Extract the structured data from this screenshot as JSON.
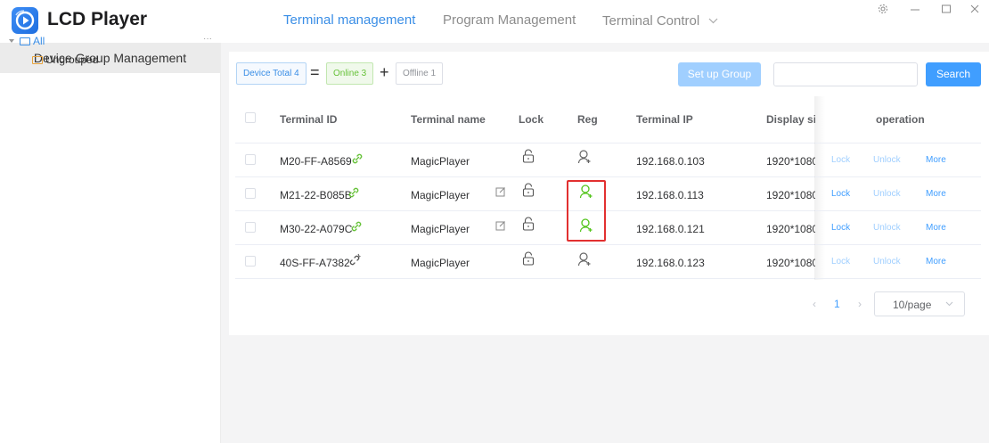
{
  "app": {
    "title": "LCD Player"
  },
  "nav": [
    {
      "label": "Terminal management",
      "active": true
    },
    {
      "label": "Program Management",
      "active": false
    },
    {
      "label": "Terminal Control",
      "active": false
    }
  ],
  "window_controls": {
    "settings": "settings-icon",
    "minimize": "minimize-icon",
    "maximize": "maximize-icon",
    "close": "close-icon"
  },
  "sidebar": {
    "title": "Device Group Management",
    "tree": [
      {
        "label": "All",
        "more": "···"
      },
      {
        "label": "Ungrouped"
      }
    ]
  },
  "summary": {
    "total": "Device Total 4",
    "equals": "=",
    "online": "Online 3",
    "plus": "+",
    "offline": "Offline 1"
  },
  "toolbar": {
    "setup_group": "Set up Group",
    "search_placeholder": "",
    "search_button": "Search"
  },
  "table": {
    "columns": [
      "Terminal ID",
      "Terminal name",
      "Lock",
      "Reg",
      "Terminal IP",
      "Display si",
      "operation"
    ],
    "rows": [
      {
        "id": "M20-FF-A8569",
        "name": "MagicPlayer",
        "editable": false,
        "reg_active": false,
        "ip": "192.168.0.103",
        "display": "1920*1080",
        "online": true
      },
      {
        "id": "M21-22-B085B",
        "name": "MagicPlayer",
        "editable": true,
        "reg_active": true,
        "ip": "192.168.0.113",
        "display": "1920*1080",
        "online": true
      },
      {
        "id": "M30-22-A079C",
        "name": "MagicPlayer",
        "editable": true,
        "reg_active": true,
        "ip": "192.168.0.121",
        "display": "1920*1080",
        "online": true
      },
      {
        "id": "40S-FF-A7382",
        "name": "MagicPlayer",
        "editable": false,
        "reg_active": false,
        "ip": "192.168.0.123",
        "display": "1920*1080",
        "online": false
      }
    ],
    "actions": {
      "lock": "Lock",
      "unlock": "Unlock",
      "more": "More"
    }
  },
  "pagination": {
    "prev": "‹",
    "page": "1",
    "next": "›",
    "page_size": "10/page"
  },
  "colors": {
    "accent": "#409eff",
    "online": "#67c23a",
    "highlight": "#e23030",
    "folder": "#e6a23c"
  }
}
